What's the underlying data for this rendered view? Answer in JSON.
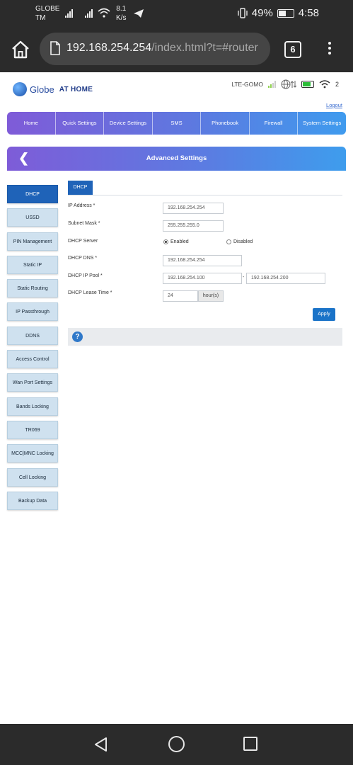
{
  "status_bar": {
    "carrier_line1": "GLOBE",
    "carrier_line2": "TM",
    "speed_value": "8.1",
    "speed_unit": "K/s",
    "battery": "49%",
    "time": "4:58"
  },
  "browser": {
    "url_host": "192.168.254.254",
    "url_path": "/index.html?t=#router",
    "tab_count": "6"
  },
  "header": {
    "brand_globe": "Globe",
    "brand_home": "AT HOME",
    "network_label": "LTE-GOMO",
    "wifi_sub": "2",
    "logout": "Logout"
  },
  "main_nav": [
    "Home",
    "Quick Settings",
    "Device Settings",
    "SMS",
    "Phonebook",
    "Firewall",
    "System Settings"
  ],
  "page_title": "Advanced Settings",
  "sidebar": [
    {
      "label": "DHCP",
      "active": true
    },
    {
      "label": "USSD",
      "active": false
    },
    {
      "label": "PIN Management",
      "active": false
    },
    {
      "label": "Static IP",
      "active": false
    },
    {
      "label": "Static Routing",
      "active": false
    },
    {
      "label": "IP Passthrough",
      "active": false
    },
    {
      "label": "DDNS",
      "active": false
    },
    {
      "label": "Access Control",
      "active": false
    },
    {
      "label": "Wan Port Settings",
      "active": false
    },
    {
      "label": "Bands Locking",
      "active": false
    },
    {
      "label": "TR069",
      "active": false
    },
    {
      "label": "MCC|MNC Locking",
      "active": false
    },
    {
      "label": "Cell Locking",
      "active": false
    },
    {
      "label": "Backup Data",
      "active": false
    }
  ],
  "form": {
    "tab": "DHCP",
    "ip_address_label": "IP Address *",
    "ip_address": "192.168.254.254",
    "subnet_label": "Subnet Mask *",
    "subnet": "255.255.255.0",
    "dhcp_server_label": "DHCP Server",
    "enabled_label": "Enabled",
    "disabled_label": "Disabled",
    "dhcp_server_enabled": true,
    "dns_label": "DHCP DNS *",
    "dns": "192.168.254.254",
    "pool_label": "DHCP IP Pool *",
    "pool_start": "192.168.254.100",
    "pool_separator": "-",
    "pool_end": "192.168.254.200",
    "lease_label": "DHCP Lease Time *",
    "lease_value": "24",
    "lease_unit": "hour(s)",
    "apply": "Apply",
    "help_glyph": "?"
  }
}
